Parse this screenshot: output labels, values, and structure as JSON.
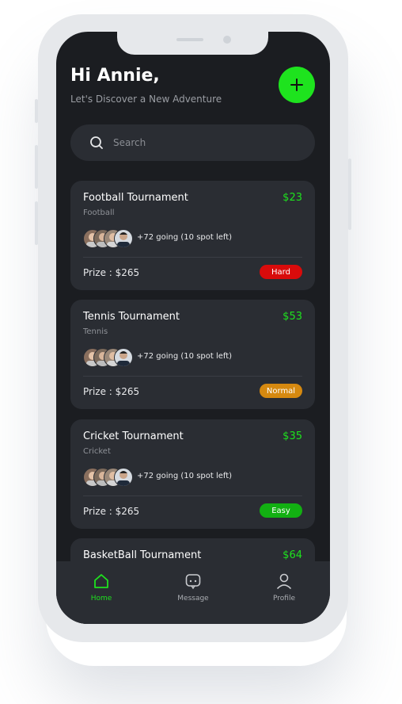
{
  "header": {
    "greeting": "Hi Annie,",
    "subtitle": "Let's Discover a New Adventure",
    "add_icon": "plus-icon"
  },
  "search": {
    "placeholder": "Search",
    "icon": "search-icon"
  },
  "cards": [
    {
      "title": "Football Tournament",
      "price": "$23",
      "category": "Football",
      "going": "+72 going (10 spot left)",
      "prize": "Prize : $265",
      "difficulty": "Hard",
      "badge_color": "#d90b0b"
    },
    {
      "title": "Tennis Tournament",
      "price": "$53",
      "category": "Tennis",
      "going": "+72 going (10 spot left)",
      "prize": "Prize : $265",
      "difficulty": "Normal",
      "badge_color": "#d68910"
    },
    {
      "title": "Cricket Tournament",
      "price": "$35",
      "category": "Cricket",
      "going": "+72 going (10 spot left)",
      "prize": "Prize : $265",
      "difficulty": "Easy",
      "badge_color": "#12b012"
    },
    {
      "title": "BasketBall Tournament",
      "price": "$64"
    }
  ],
  "nav": [
    {
      "label": "Home",
      "icon": "home-icon",
      "active": true
    },
    {
      "label": "Message",
      "icon": "message-icon",
      "active": false
    },
    {
      "label": "Profile",
      "icon": "profile-icon",
      "active": false
    }
  ],
  "colors": {
    "accent": "#1ee31e",
    "background": "#1b1d21",
    "card": "#2a2d33"
  }
}
